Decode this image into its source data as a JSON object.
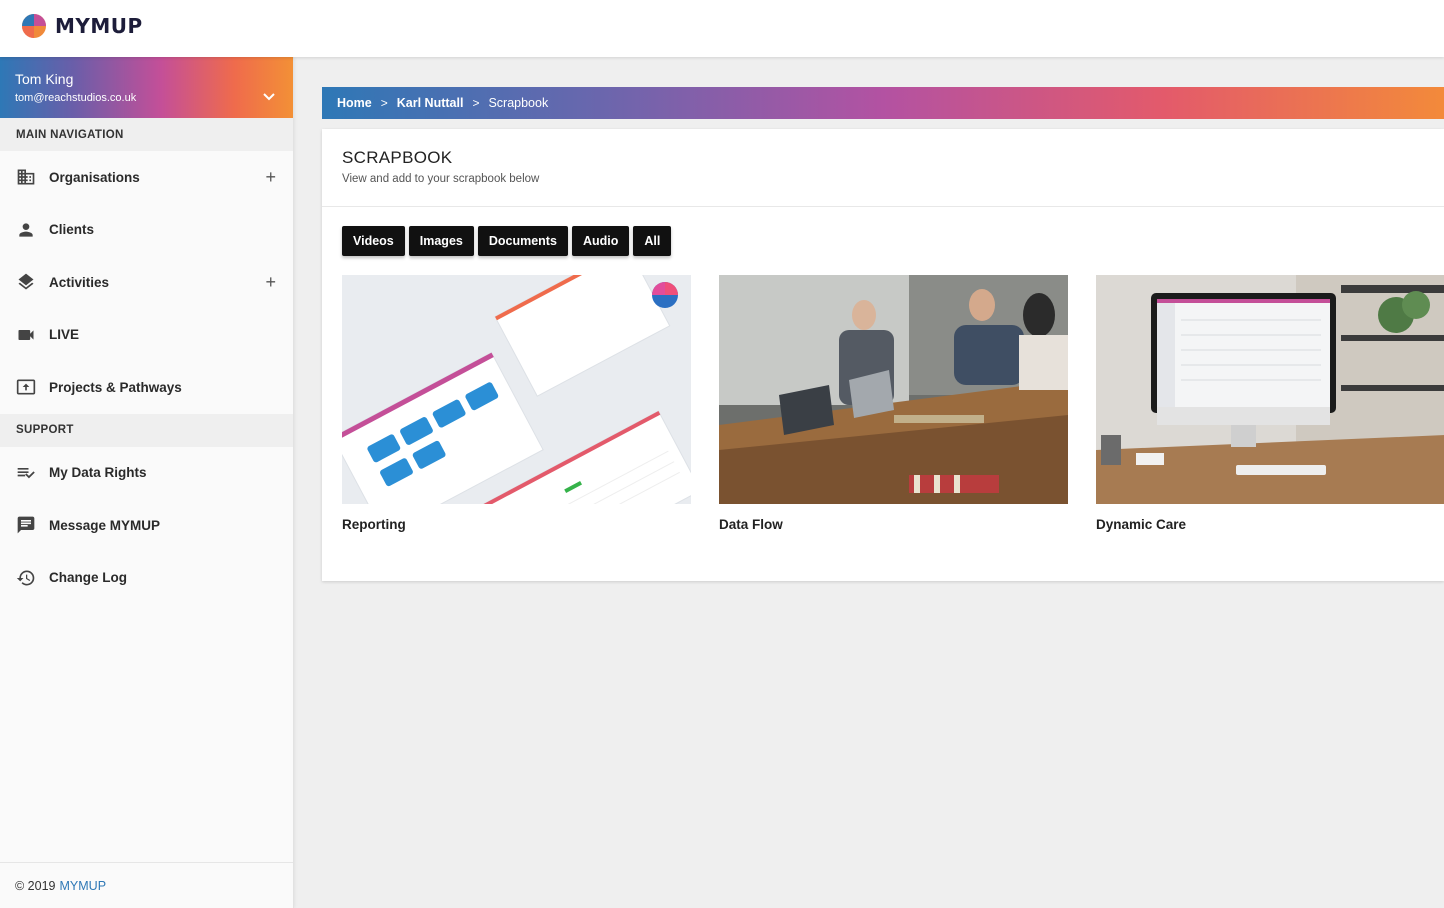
{
  "app": {
    "brand": "MYMUP"
  },
  "user": {
    "name": "Tom King",
    "email": "tom@reachstudios.co.uk"
  },
  "sidebar": {
    "main_header": "MAIN NAVIGATION",
    "main_items": [
      {
        "label": "Organisations",
        "icon": "building-icon",
        "expandable": true
      },
      {
        "label": "Clients",
        "icon": "person-icon",
        "expandable": false
      },
      {
        "label": "Activities",
        "icon": "layers-icon",
        "expandable": true
      },
      {
        "label": "LIVE",
        "icon": "video-camera-icon",
        "expandable": false
      },
      {
        "label": "Projects & Pathways",
        "icon": "upload-box-icon",
        "expandable": false
      }
    ],
    "support_header": "SUPPORT",
    "support_items": [
      {
        "label": "My Data Rights",
        "icon": "list-check-icon"
      },
      {
        "label": "Message MYMUP",
        "icon": "message-icon"
      },
      {
        "label": "Change Log",
        "icon": "history-icon"
      }
    ],
    "plus_symbol": "+"
  },
  "footer": {
    "copyright": "© 2019",
    "brand": "MYMUP"
  },
  "breadcrumb": {
    "items": [
      "Home",
      "Karl Nuttall",
      "Scrapbook"
    ],
    "separator": ">"
  },
  "scrapbook": {
    "title": "SCRAPBOOK",
    "subtitle": "View and add to your scrapbook below",
    "filters": [
      "Videos",
      "Images",
      "Documents",
      "Audio",
      "All"
    ],
    "items": [
      {
        "title": "Reporting"
      },
      {
        "title": "Data Flow"
      },
      {
        "title": "Dynamic Care"
      }
    ]
  },
  "colors": {
    "accent_blue": "#2e78b6",
    "gradient_purple": "#b352a2",
    "gradient_orange": "#f38a3a",
    "button_dark": "#111111"
  }
}
